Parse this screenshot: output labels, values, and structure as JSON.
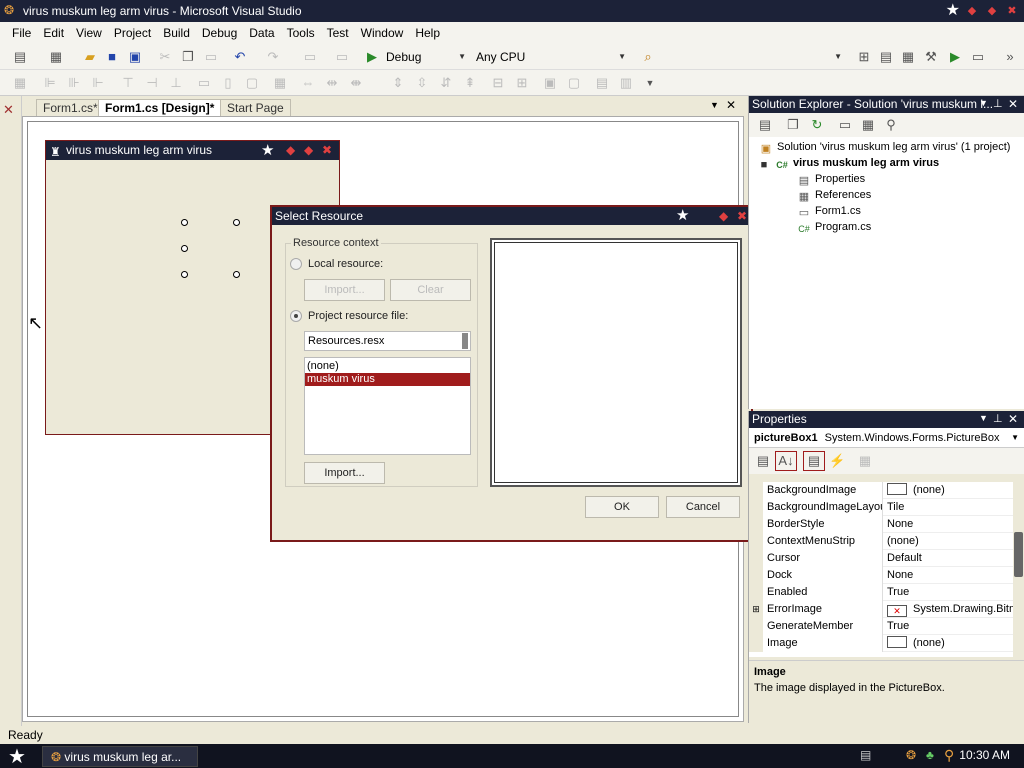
{
  "window": {
    "title": "virus muskum leg arm virus - Microsoft Visual Studio"
  },
  "menu": [
    "File",
    "Edit",
    "View",
    "Project",
    "Build",
    "Debug",
    "Data",
    "Tools",
    "Test",
    "Window",
    "Help"
  ],
  "toolbar": {
    "config": "Debug",
    "platform": "Any CPU"
  },
  "tabs": [
    {
      "label": "Form1.cs*",
      "active": false
    },
    {
      "label": "Form1.cs [Design]*",
      "active": true
    },
    {
      "label": "Start Page",
      "active": false
    }
  ],
  "form": {
    "title": "virus muskum leg arm virus"
  },
  "dialog": {
    "title": "Select Resource",
    "context_legend": "Resource context",
    "local_label": "Local resource:",
    "import_btn_disabled": "Import...",
    "clear_btn_disabled": "Clear",
    "project_label": "Project resource file:",
    "resx_file": "Resources.resx",
    "resources": [
      {
        "label": "(none)",
        "selected": false
      },
      {
        "label": "muskum virus",
        "selected": true
      }
    ],
    "import_button": "Import...",
    "ok_button": "OK",
    "cancel_button": "Cancel"
  },
  "solution_explorer": {
    "title": "Solution Explorer - Solution 'virus muskum l...",
    "solution": "Solution 'virus muskum leg arm virus' (1 project)",
    "project": "virus muskum leg arm virus",
    "items": [
      "Properties",
      "References",
      "Form1.cs",
      "Program.cs"
    ]
  },
  "properties": {
    "title": "Properties",
    "object": "pictureBox1",
    "object_type": "System.Windows.Forms.PictureBox",
    "rows": [
      {
        "name": "BackgroundImage",
        "value": "(none)",
        "swatch": "white"
      },
      {
        "name": "BackgroundImageLayou",
        "value": "Tile"
      },
      {
        "name": "BorderStyle",
        "value": "None"
      },
      {
        "name": "ContextMenuStrip",
        "value": "(none)"
      },
      {
        "name": "Cursor",
        "value": "Default"
      },
      {
        "name": "Dock",
        "value": "None"
      },
      {
        "name": "Enabled",
        "value": "True"
      },
      {
        "name": "ErrorImage",
        "value": "System.Drawing.Bitm",
        "swatch": "error",
        "expandable": true
      },
      {
        "name": "GenerateMember",
        "value": "True"
      },
      {
        "name": "Image",
        "value": "(none)",
        "swatch": "white"
      }
    ],
    "desc_title": "Image",
    "desc_text": "The image displayed in the PictureBox."
  },
  "status": {
    "text": "Ready"
  },
  "taskbar": {
    "task": "virus muskum leg ar...",
    "clock": "10:30 AM"
  }
}
